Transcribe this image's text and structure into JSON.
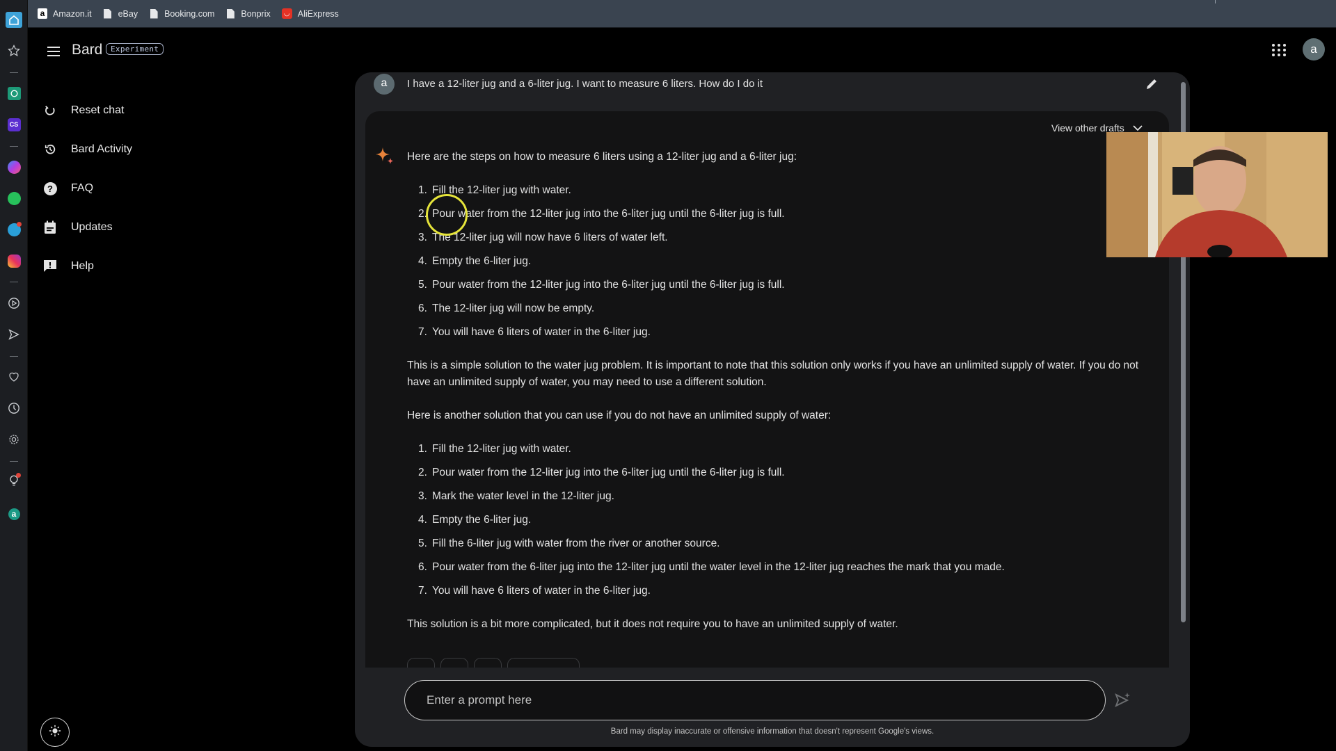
{
  "browser": {
    "bookmarks": [
      {
        "label": "Amazon.it",
        "icon": "amazon-icon"
      },
      {
        "label": "eBay",
        "icon": "page-icon"
      },
      {
        "label": "Booking.com",
        "icon": "page-icon"
      },
      {
        "label": "Bonprix",
        "icon": "page-icon"
      },
      {
        "label": "AliExpress",
        "icon": "aliexpress-icon"
      }
    ]
  },
  "dock": {
    "items": [
      "home-icon",
      "star-icon",
      "chatgpt-icon",
      "cs-app-icon",
      "messenger-icon",
      "whatsapp-icon",
      "telegram-icon",
      "instagram-icon",
      "play-icon",
      "send-icon",
      "heart-icon",
      "clock-icon",
      "settings-icon",
      "lightbulb-icon",
      "account-icon"
    ],
    "account_letter": "a"
  },
  "header": {
    "app_name": "Bard",
    "badge": "Experiment",
    "account_letter": "a"
  },
  "sidebar": {
    "items": [
      {
        "label": "Reset chat",
        "icon": "reset-icon"
      },
      {
        "label": "Bard Activity",
        "icon": "history-icon"
      },
      {
        "label": "FAQ",
        "icon": "help-circle-icon"
      },
      {
        "label": "Updates",
        "icon": "calendar-icon"
      },
      {
        "label": "Help",
        "icon": "feedback-icon"
      }
    ]
  },
  "chat": {
    "user_avatar_letter": "a",
    "user_prompt": "I have a 12-liter jug and a 6-liter jug. I want to measure 6 liters. How do I do it",
    "view_drafts_label": "View other drafts",
    "response": {
      "intro": "Here are the steps on how to measure 6 liters using a 12-liter jug and a 6-liter jug:",
      "steps_1": [
        "Fill the 12-liter jug with water.",
        "Pour water from the 12-liter jug into the 6-liter jug until the 6-liter jug is full.",
        "The 12-liter jug will now have 6 liters of water left.",
        "Empty the 6-liter jug.",
        "Pour water from the 12-liter jug into the 6-liter jug until the 6-liter jug is full.",
        "The 12-liter jug will now be empty.",
        "You will have 6 liters of water in the 6-liter jug."
      ],
      "note": "This is a simple solution to the water jug problem. It is important to note that this solution only works if you have an unlimited supply of water. If you do not have an unlimited supply of water, you may need to use a different solution.",
      "intro_2": "Here is another solution that you can use if you do not have an unlimited supply of water:",
      "steps_2": [
        "Fill the 12-liter jug with water.",
        "Pour water from the 12-liter jug into the 6-liter jug until the 6-liter jug is full.",
        "Mark the water level in the 12-liter jug.",
        "Empty the 6-liter jug.",
        "Fill the 6-liter jug with water from the river or another source.",
        "Pour water from the 6-liter jug into the 12-liter jug until the water level in the 12-liter jug reaches the mark that you made.",
        "You will have 6 liters of water in the 6-liter jug."
      ],
      "conclusion": "This solution is a bit more complicated, but it does not require you to have an unlimited supply of water."
    },
    "input_placeholder": "Enter a prompt here",
    "input_value": "",
    "disclaimer": "Bard may display inaccurate or offensive information that doesn't represent Google's views."
  },
  "colors": {
    "accent_spark": "#e8833a",
    "chat_bg": "#202124",
    "response_bg": "#131314",
    "bookmarks_bg": "#3a4450"
  }
}
